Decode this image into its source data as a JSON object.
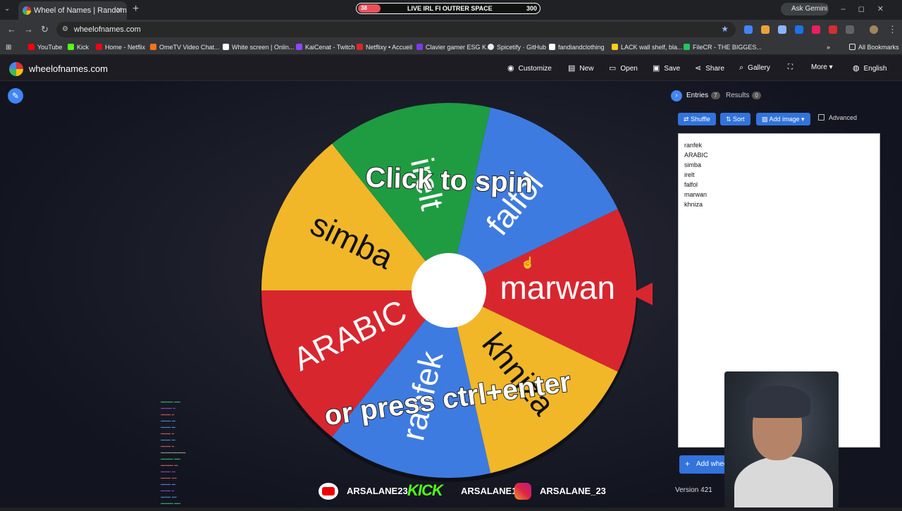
{
  "browser": {
    "tab_title": "Wheel of Names | Random nam",
    "url": "wheelofnames.com",
    "stream_banner": {
      "left_value": "38",
      "text": "LIVE IRL FI OUTRER SPACE",
      "right_value": "300"
    },
    "gemini_label": "Ask Gemini",
    "bookmarks": [
      "YouTube",
      "Kick",
      "Home - Netflix",
      "OmeTV Video Chat...",
      "White screen | Onlin...",
      "KaiCenat - Twitch",
      "Netflixy • Accueil",
      "Clavier gamer ESG K...",
      "Spicetify · GitHub",
      "fandiandclothing",
      "LACK wall shelf, bla...",
      "FileCR - THE BIGGES..."
    ],
    "all_bookmarks": "All Bookmarks"
  },
  "site": {
    "name": "wheelofnames.com",
    "menu": [
      "Customize",
      "New",
      "Open",
      "Save",
      "Share",
      "Gallery",
      "More",
      "English"
    ]
  },
  "wheel": {
    "entries": [
      "ranfek",
      "ARABIC",
      "simba",
      "irelt",
      "falfol",
      "marwan",
      "khniza"
    ],
    "colors": [
      "#3e7be0",
      "#d8262f",
      "#f1b729",
      "#1f9c41",
      "#3e7be0",
      "#d8262f",
      "#f1b729"
    ],
    "overlay_top": "Click to spin",
    "overlay_bottom": "or press ctrl+enter"
  },
  "panel": {
    "tabs": [
      {
        "label": "Entries",
        "count": "7"
      },
      {
        "label": "Results",
        "count": "0"
      }
    ],
    "buttons": [
      "Shuffle",
      "Sort",
      "Add image"
    ],
    "advanced_label": "Advanced",
    "entries_text": [
      "ranfek",
      "ARABIC",
      "simba",
      "irelt",
      "falfol",
      "marwan",
      "khniza"
    ],
    "add_wheel": "Add whee",
    "version": "Version 421"
  },
  "overlay": {
    "socials": [
      "ARSALANE23",
      "KICK",
      "ARSALANE1",
      "ARSALANE_23"
    ]
  }
}
